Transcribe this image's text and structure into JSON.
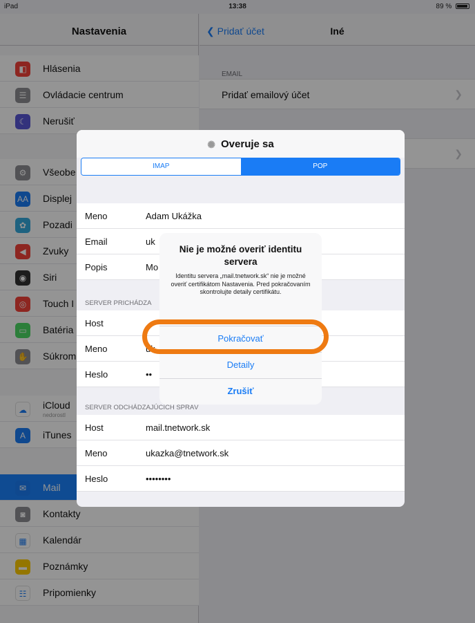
{
  "status_bar": {
    "left": "iPad",
    "time": "13:38",
    "battery": "89 %"
  },
  "sidebar": {
    "title": "Nastavenia",
    "items": [
      {
        "label": "Hlásenia",
        "icon": "notifications-icon",
        "color": "#f3423a"
      },
      {
        "label": "Ovládacie centrum",
        "icon": "control-center-icon",
        "color": "#8e8e93"
      },
      {
        "label": "Nerušiť",
        "icon": "moon-icon",
        "color": "#5856d6"
      },
      {
        "label": "Všeobe",
        "icon": "gear-icon",
        "color": "#8e8e93"
      },
      {
        "label": "Displej",
        "icon": "display-icon",
        "color": "#1a7cf5"
      },
      {
        "label": "Pozadi",
        "icon": "wallpaper-icon",
        "color": "#35aadc"
      },
      {
        "label": "Zvuky",
        "icon": "sound-icon",
        "color": "#f3423a"
      },
      {
        "label": "Siri",
        "icon": "siri-icon",
        "color": "#333333"
      },
      {
        "label": "Touch I",
        "icon": "fingerprint-icon",
        "color": "#f3423a"
      },
      {
        "label": "Batéria",
        "icon": "battery-icon",
        "color": "#4cd964"
      },
      {
        "label": "Súkrom",
        "icon": "privacy-hand-icon",
        "color": "#8e8e93"
      },
      {
        "label": "iCloud",
        "sub": "nedorostl",
        "icon": "cloud-icon",
        "color": "#ffffff"
      },
      {
        "label": "iTunes",
        "icon": "app-store-icon",
        "color": "#1a7cf5"
      },
      {
        "label": "Mail",
        "icon": "mail-icon",
        "color": "#1a7cf5"
      },
      {
        "label": "Kontakty",
        "icon": "contacts-icon",
        "color": "#8e8e93"
      },
      {
        "label": "Kalendár",
        "icon": "calendar-icon",
        "color": "#ffffff"
      },
      {
        "label": "Poznámky",
        "icon": "notes-icon",
        "color": "#ffcc00"
      },
      {
        "label": "Pripomienky",
        "icon": "reminders-icon",
        "color": "#ffffff"
      }
    ]
  },
  "detail": {
    "back_label": "Pridať účet",
    "title": "Iné",
    "email_header": "EMAIL",
    "add_email_label": "Pridať emailový účet"
  },
  "sheet": {
    "title": "Overuje sa",
    "segments": {
      "imap": "IMAP",
      "pop": "POP"
    },
    "account": [
      {
        "key": "Meno",
        "value": "Adam Ukážka"
      },
      {
        "key": "Email",
        "value": "uk"
      },
      {
        "key": "Popis",
        "value": "Mo"
      }
    ],
    "incoming_header": "SERVER PRICHÁDZA",
    "incoming": [
      {
        "key": "Host",
        "value": ""
      },
      {
        "key": "Meno",
        "value": "uk"
      },
      {
        "key": "Heslo",
        "value": "••"
      }
    ],
    "outgoing_header": "SERVER ODCHÁDZAJÚCICH SPRÁV",
    "outgoing": [
      {
        "key": "Host",
        "value": "mail.tnetwork.sk"
      },
      {
        "key": "Meno",
        "value": "ukazka@tnetwork.sk"
      },
      {
        "key": "Heslo",
        "value": "••••••••"
      }
    ]
  },
  "alert": {
    "title": "Nie je možné overiť identitu servera",
    "message": "Identitu servera „mail.tnetwork.sk“ nie je možné overiť certifikátom Nastavenia. Pred pokračovaním skontrolujte detaily certifikátu.",
    "continue_label": "Pokračovať",
    "details_label": "Detaily",
    "cancel_label": "Zrušiť"
  },
  "colors": {
    "accent": "#1a7cf5",
    "highlight": "#ee7a12",
    "selected": "#1a82fb"
  }
}
